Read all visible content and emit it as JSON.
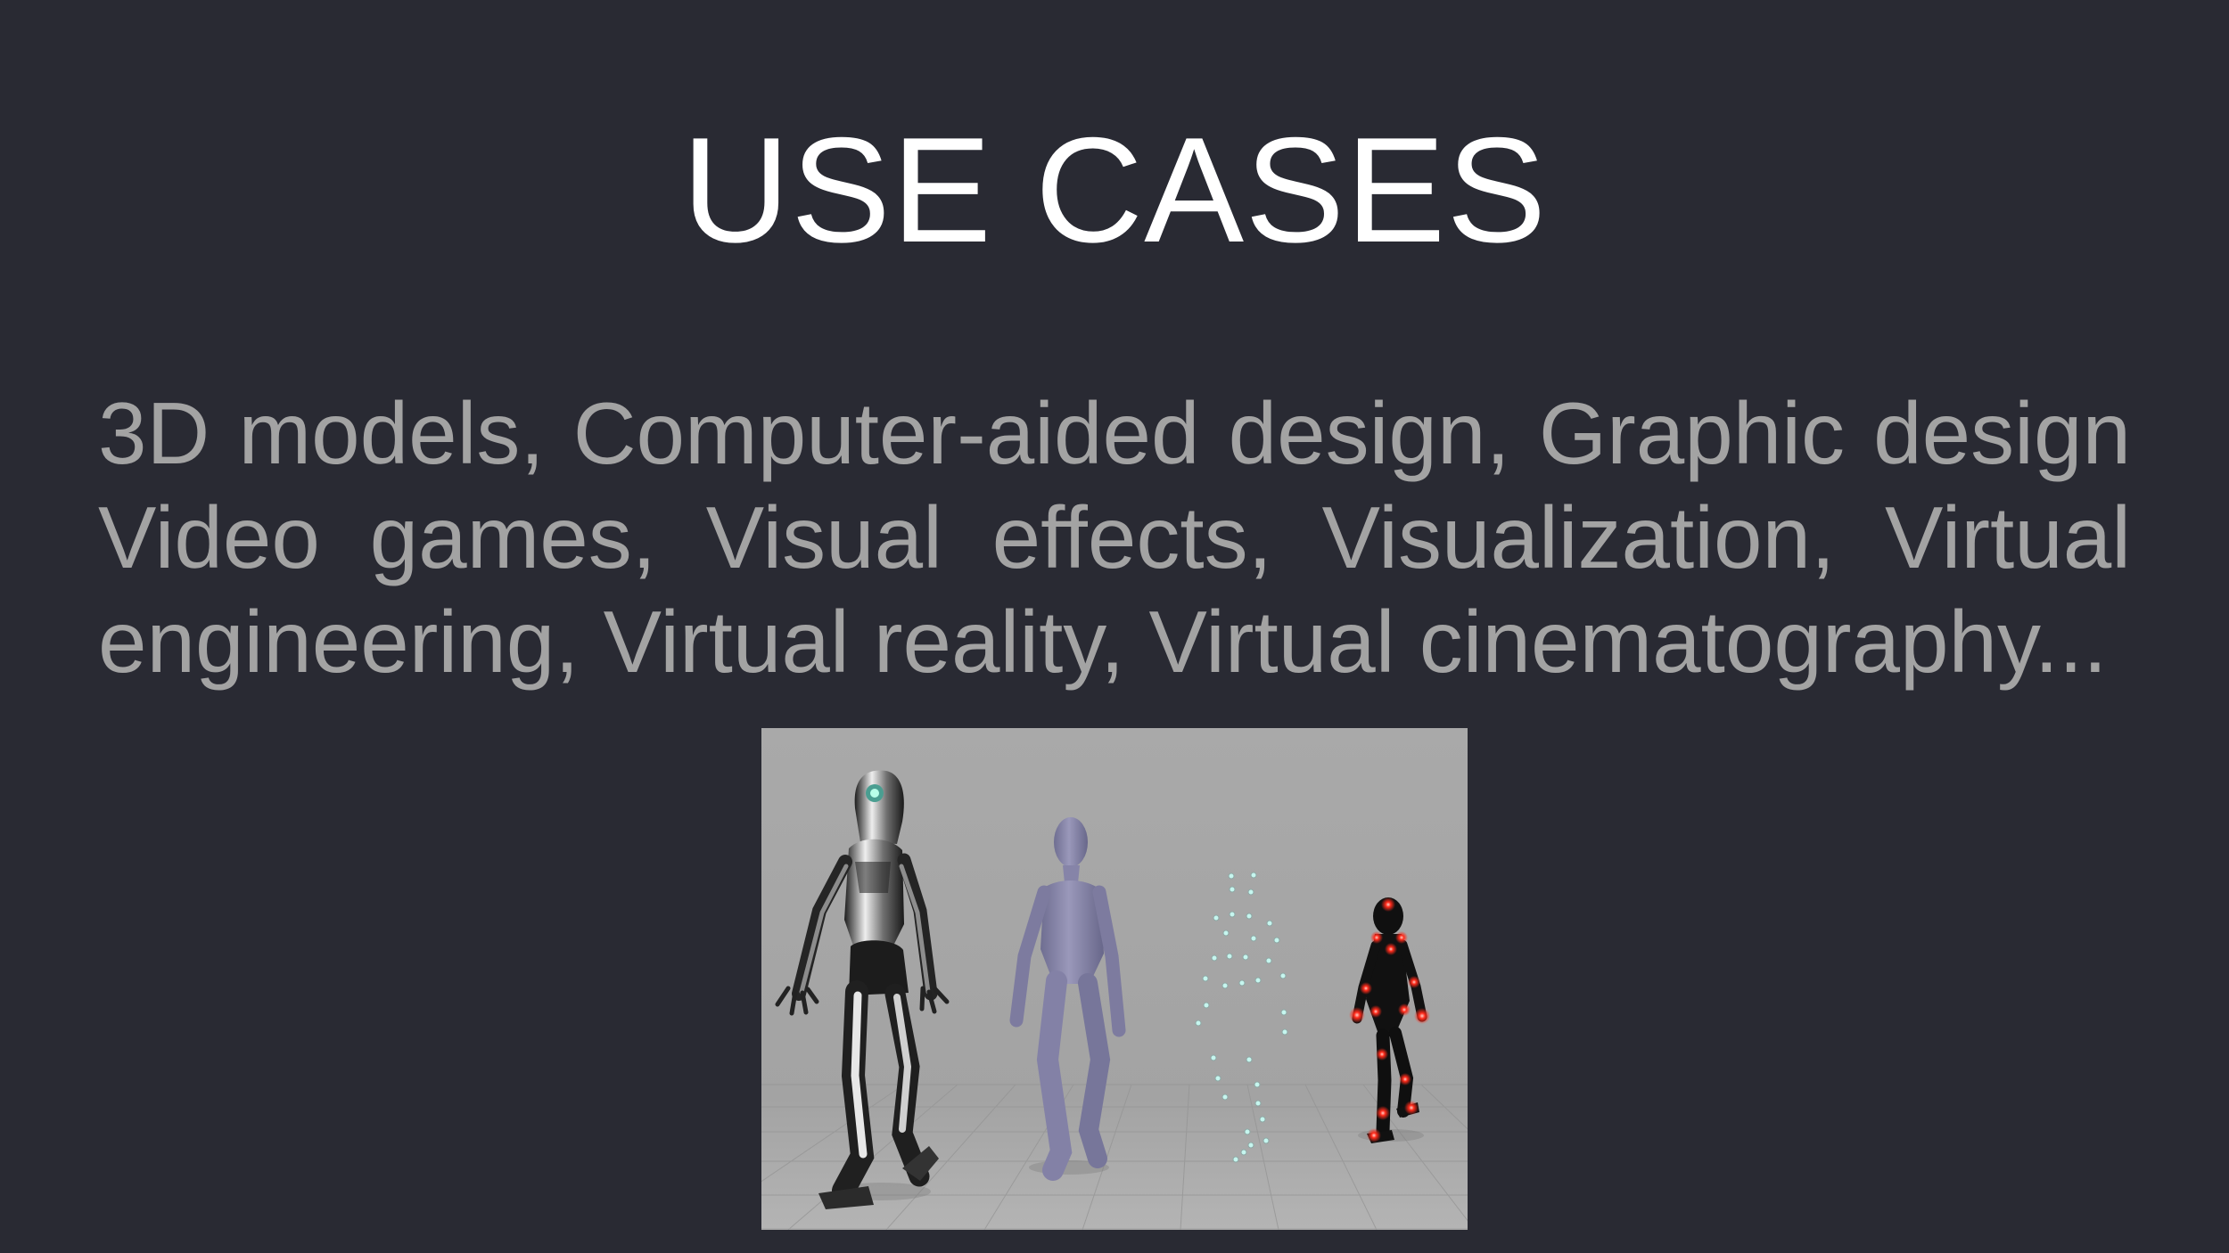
{
  "slide": {
    "title": "USE CASES",
    "body_lines": [
      [
        "3D",
        "models,",
        "Computer-aided",
        "design,",
        "Graphic",
        "design"
      ],
      [
        "Video",
        "games,",
        "Visual",
        "effects,",
        "Visualization,",
        "Virtual"
      ],
      [
        "engineering, Virtual reality, Virtual cinematography..."
      ]
    ]
  },
  "figures": {
    "robot": {
      "icon": "robot-figure"
    },
    "mannequin": {
      "icon": "mannequin-figure"
    },
    "point_cloud": {
      "icon": "mocap-point-cloud"
    },
    "mocap_actor": {
      "icon": "mocap-suit-actor"
    }
  },
  "colors": {
    "background": "#292a33",
    "title": "#ffffff",
    "body": "#a3a3a3",
    "image_background": "#a7a7a7",
    "marker_red": "#ff2a1a",
    "marker_cyan": "#bff3ea",
    "mannequin": "#8b8aa9"
  }
}
